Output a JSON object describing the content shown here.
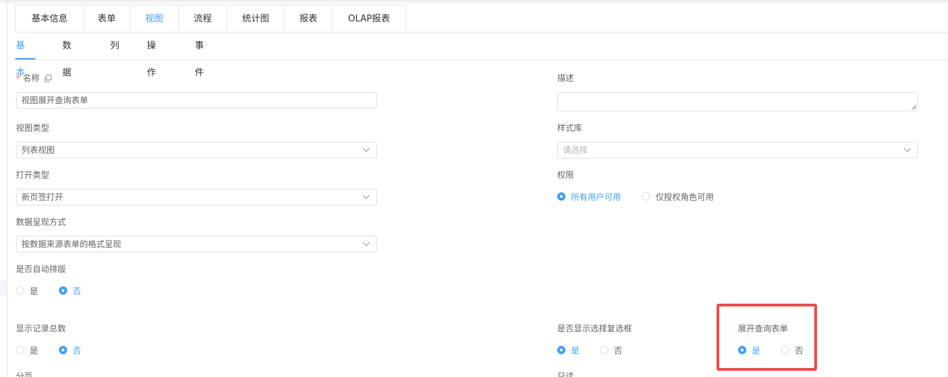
{
  "tabs": [
    "基本信息",
    "表单",
    "视图",
    "流程",
    "统计图",
    "报表",
    "OLAP报表"
  ],
  "active_tab": "视图",
  "subtabs": [
    "基本",
    "数据",
    "列",
    "操作",
    "事件"
  ],
  "active_subtab": "基本",
  "form": {
    "name": {
      "required_mark": "*",
      "label": "名称",
      "value": "视图展开查询表单",
      "copy_icon": "copy-icon"
    },
    "description": {
      "label": "描述",
      "value": ""
    },
    "view_type": {
      "label": "视图类型",
      "value": "列表视图"
    },
    "style_lib": {
      "label": "样式库",
      "placeholder": "请选择"
    },
    "open_type": {
      "label": "打开类型",
      "value": "新页签打开"
    },
    "permission": {
      "label": "权限",
      "options": [
        "所有用户可用",
        "仅授权角色可用"
      ],
      "selected": "所有用户可用"
    },
    "data_display": {
      "label": "数据呈现方式",
      "value": "按数据来源表单的格式呈现"
    },
    "auto_layout": {
      "label": "是否自动排版",
      "options": [
        "是",
        "否"
      ],
      "selected": "否"
    },
    "show_total": {
      "label": "显示记录总数",
      "options": [
        "是",
        "否"
      ],
      "selected": "否"
    },
    "show_checkbox": {
      "label": "是否显示选择复选框",
      "options": [
        "是",
        "否"
      ],
      "selected": "是"
    },
    "expand_query": {
      "label": "展开查询表单",
      "options": [
        "是",
        "否"
      ],
      "selected": "是"
    },
    "pagination": {
      "label": "分页"
    },
    "readonly": {
      "label": "只读"
    }
  },
  "colors": {
    "accent": "#409eff",
    "highlight_box": "#e84c4c",
    "required": "#f56c6c",
    "border": "#dcdfe6"
  }
}
